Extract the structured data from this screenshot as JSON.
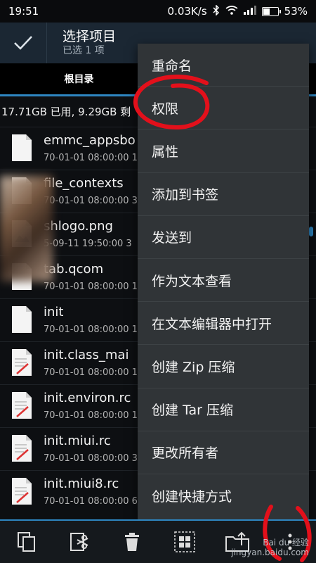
{
  "status_bar": {
    "time": "19:51",
    "net_speed": "0.03K/s",
    "battery": "53%",
    "battery_level": 0.53
  },
  "action_bar": {
    "title": "选择项目",
    "subtitle": "已选 1 项"
  },
  "tabs": [
    {
      "label": "根目录"
    }
  ],
  "storage_info": "17.71GB 已用, 9.29GB 剩",
  "files": [
    {
      "name": "emmc_appsbo",
      "meta": "70-01-01 08:00:00  1",
      "icon": "file-icon"
    },
    {
      "name": "file_contexts",
      "meta": "70-01-01 08:00:00  3",
      "icon": "file-icon"
    },
    {
      "name": "shlogo.png",
      "meta": "5-09-11 19:50:00  3",
      "icon": "image-file-icon"
    },
    {
      "name": "tab.qcom",
      "meta": "70-01-01 08:00:00  1",
      "icon": "file-icon"
    },
    {
      "name": "init",
      "meta": "70-01-01 08:00:00  1",
      "icon": "file-icon"
    },
    {
      "name": "init.class_mai",
      "meta": "70-01-01 08:00:00  1",
      "icon": "script-file-icon"
    },
    {
      "name": "init.environ.rc",
      "meta": "70-01-01 08:00:00  1",
      "icon": "script-file-icon"
    },
    {
      "name": "init.miui.rc",
      "meta": "70-01-01 08:00:00  3",
      "icon": "script-file-icon"
    },
    {
      "name": "init.miui8.rc",
      "meta": "70-01-01 08:00:00  6",
      "icon": "script-file-icon"
    }
  ],
  "context_menu": [
    "重命名",
    "权限",
    "属性",
    "添加到书签",
    "发送到",
    "作为文本查看",
    "在文本编辑器中打开",
    "创建 Zip 压缩",
    "创建 Tar 压缩",
    "更改所有者",
    "创建快捷方式"
  ],
  "bottom_toolbar": [
    {
      "icon": "copy-icon"
    },
    {
      "icon": "cut-icon"
    },
    {
      "icon": "delete-icon"
    },
    {
      "icon": "select-all-icon"
    },
    {
      "icon": "move-to-folder-icon"
    },
    {
      "icon": "more-icon"
    }
  ],
  "watermark": {
    "brand": "Bai du 经验",
    "url": "jingyan.baidu.com"
  },
  "colors": {
    "accent": "#2e86c1",
    "annotation": "#e3101b",
    "menu_bg": "#303437"
  }
}
